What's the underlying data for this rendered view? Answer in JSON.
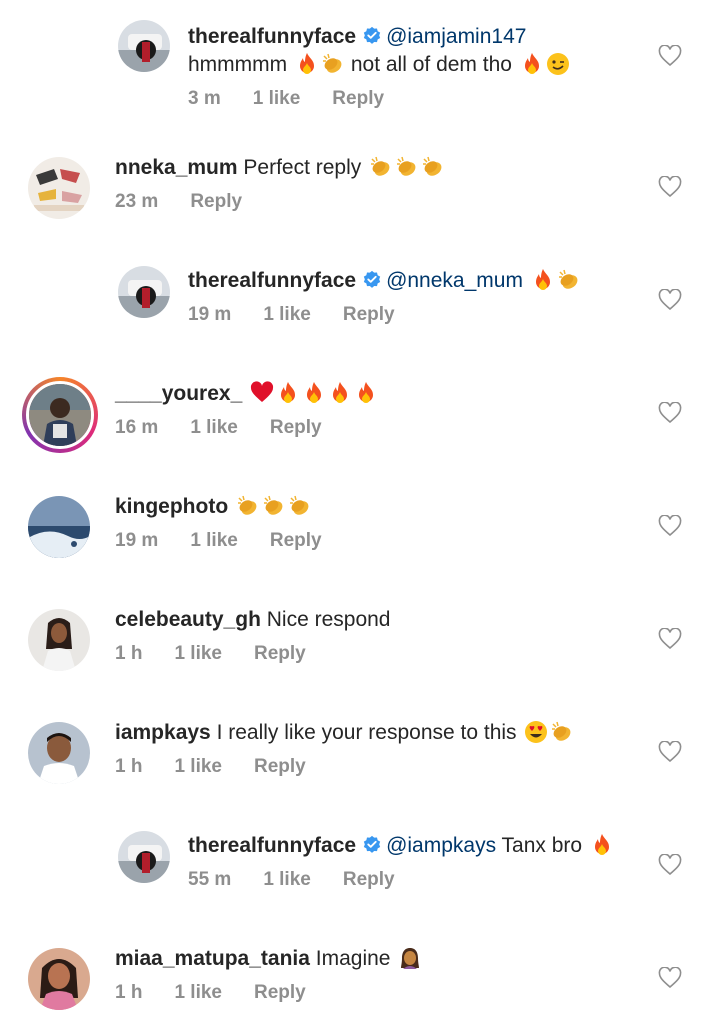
{
  "comments": [
    {
      "user": "therealfunnyface",
      "mention": "@iamjamin147",
      "text": "hmmmmm",
      "text2": "not all of dem tho",
      "time": "3 m",
      "likes": "1 like",
      "reply": "Reply"
    },
    {
      "user": "nneka_mum",
      "text": "Perfect reply",
      "time": "23 m",
      "reply": "Reply"
    },
    {
      "user": "therealfunnyface",
      "mention": "@nneka_mum",
      "time": "19 m",
      "likes": "1 like",
      "reply": "Reply"
    },
    {
      "user": "____yourex_",
      "time": "16 m",
      "likes": "1 like",
      "reply": "Reply"
    },
    {
      "user": "kingephoto",
      "time": "19 m",
      "likes": "1 like",
      "reply": "Reply"
    },
    {
      "user": "celebeauty_gh",
      "text": "Nice respond",
      "time": "1 h",
      "likes": "1 like",
      "reply": "Reply"
    },
    {
      "user": "iampkays",
      "text": "I really like your response to this",
      "time": "1 h",
      "likes": "1 like",
      "reply": "Reply"
    },
    {
      "user": "therealfunnyface",
      "mention": "@iampkays",
      "text": "Tanx bro",
      "time": "55 m",
      "likes": "1 like",
      "reply": "Reply"
    },
    {
      "user": "miaa_matupa_tania",
      "text": "Imagine",
      "time": "1 h",
      "likes": "1 like",
      "reply": "Reply"
    }
  ],
  "icons": {
    "heart": "heart-outline-icon",
    "verified": "verified-badge-icon",
    "fire": "fire-emoji",
    "clap": "clap-emoji",
    "heart_red": "red-heart-emoji",
    "wink": "wink-emoji",
    "love_eyes": "heart-eyes-emoji",
    "woman": "woman-emoji"
  },
  "colors": {
    "username": "#262626",
    "mention": "#00376b",
    "meta": "#8e8e8e",
    "verified": "#3897f0"
  }
}
